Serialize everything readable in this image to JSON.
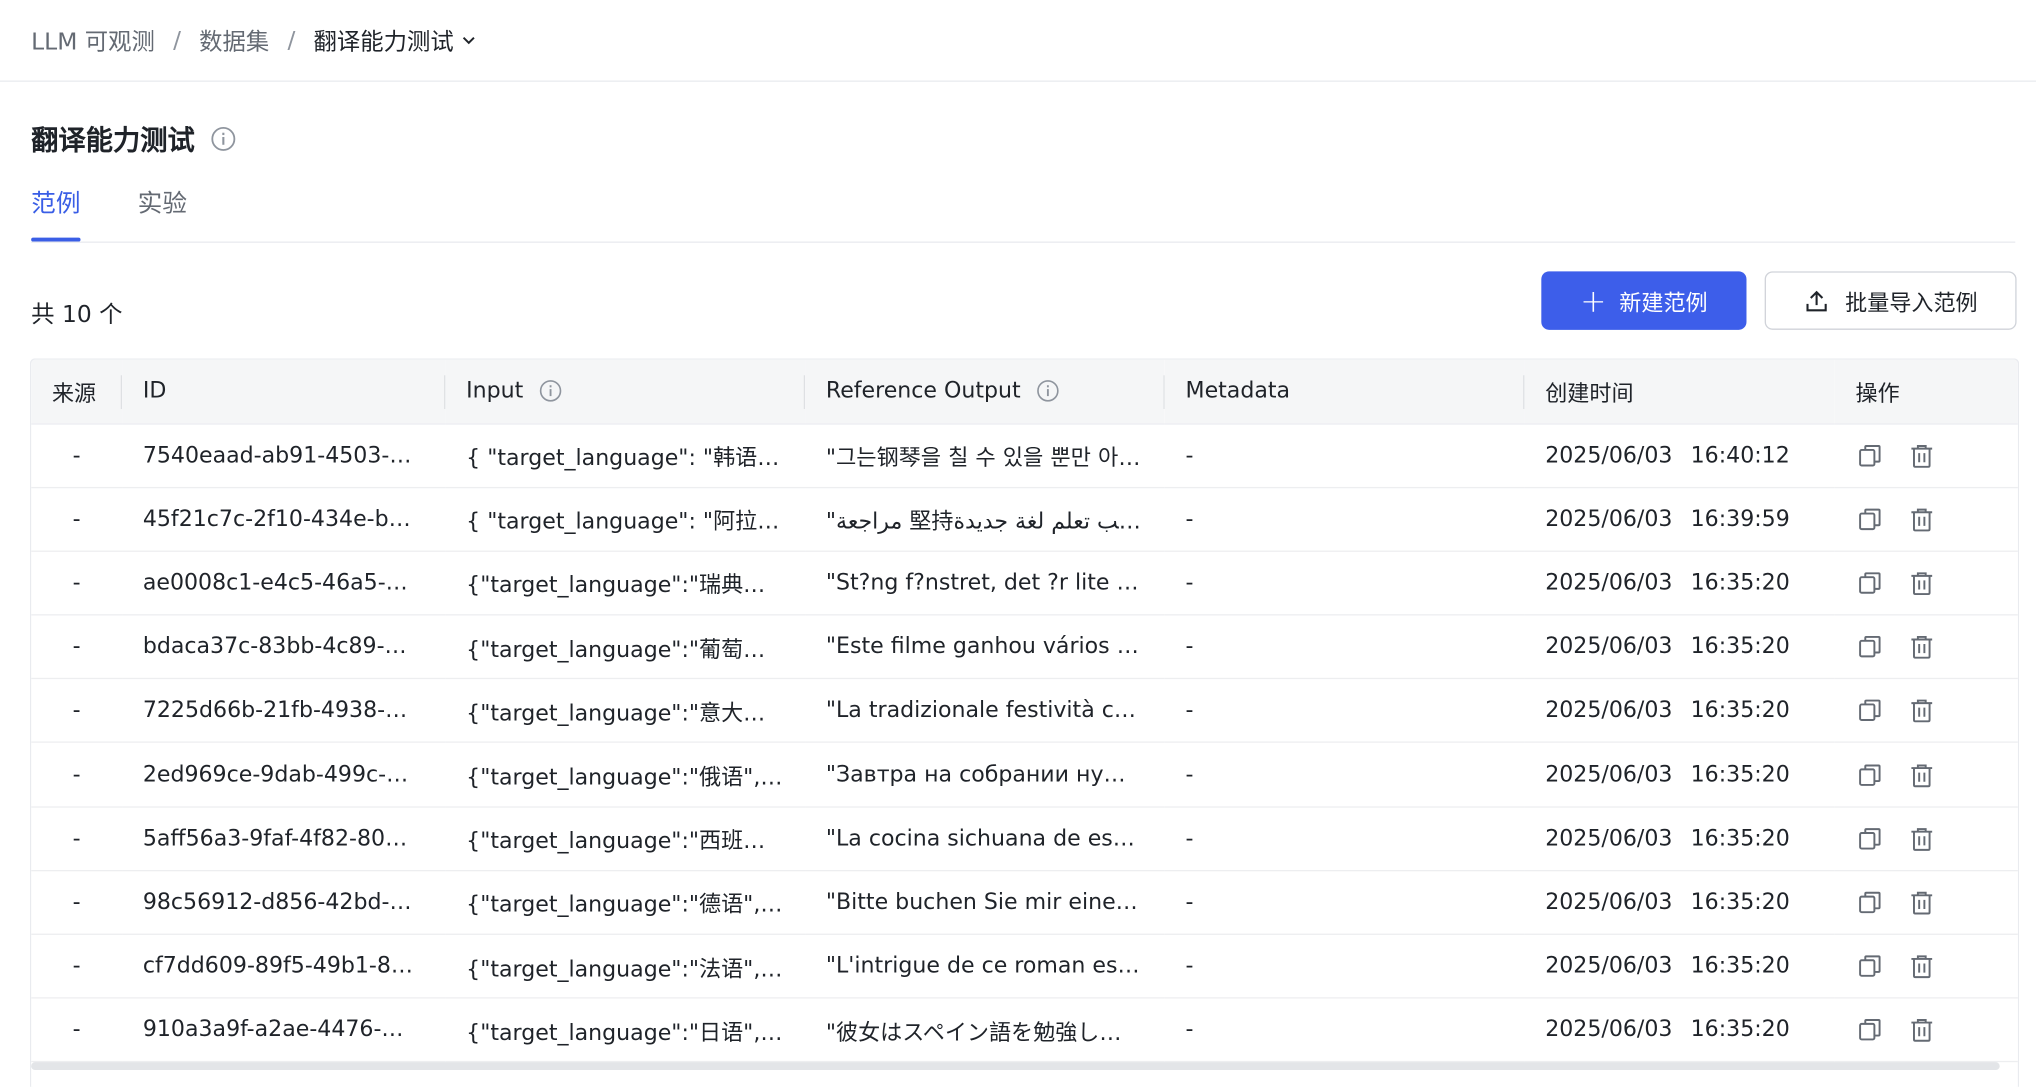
{
  "breadcrumb": {
    "items": [
      "LLM 可观测",
      "数据集"
    ],
    "current": "翻译能力测试",
    "separator": "/"
  },
  "page": {
    "title": "翻译能力测试"
  },
  "tabs": [
    {
      "label": "范例",
      "active": true
    },
    {
      "label": "实验",
      "active": false
    }
  ],
  "summary": {
    "count_text": "共 10 个"
  },
  "actions": {
    "new_label": "新建范例",
    "import_label": "批量导入范例"
  },
  "colors": {
    "accent": "#3d5eea",
    "text": "#1f2329",
    "muted": "#646a73"
  },
  "table": {
    "columns": {
      "source": "来源",
      "id": "ID",
      "input": "Input",
      "reference_output": "Reference Output",
      "metadata": "Metadata",
      "created": "创建时间",
      "ops": "操作"
    },
    "rows": [
      {
        "source": "-",
        "id": "7540eaad-ab91-4503-…",
        "input": "{ \"target_language\": \"韩语…",
        "output": "\"그는钢琴을 칠 수 있을 뿐만 아…",
        "metadata": "-",
        "date": "2025/06/03",
        "time": "16:40:12"
      },
      {
        "source": "-",
        "id": "45f21c7c-2f10-434e-b…",
        "input": "{ \"target_language\": \"阿拉…",
        "output": "\"مراجعة 堅持تتطلب تعلم لغة جديدة…",
        "metadata": "-",
        "date": "2025/06/03",
        "time": "16:39:59"
      },
      {
        "source": "-",
        "id": "ae0008c1-e4c5-46a5-…",
        "input": "{\"target_language\":\"瑞典…",
        "output": "\"St?ng f?nstret, det ?r lite k…",
        "metadata": "-",
        "date": "2025/06/03",
        "time": "16:35:20"
      },
      {
        "source": "-",
        "id": "bdaca37c-83bb-4c89-…",
        "input": "{\"target_language\":\"葡萄…",
        "output": "\"Este filme ganhou vários …",
        "metadata": "-",
        "date": "2025/06/03",
        "time": "16:35:20"
      },
      {
        "source": "-",
        "id": "7225d66b-21fb-4938-…",
        "input": "{\"target_language\":\"意大…",
        "output": "\"La tradizionale festività c…",
        "metadata": "-",
        "date": "2025/06/03",
        "time": "16:35:20"
      },
      {
        "source": "-",
        "id": "2ed969ce-9dab-499c-…",
        "input": "{\"target_language\":\"俄语\",…",
        "output": "\"Завтра на собрании ну…",
        "metadata": "-",
        "date": "2025/06/03",
        "time": "16:35:20"
      },
      {
        "source": "-",
        "id": "5aff56a3-9faf-4f82-80…",
        "input": "{\"target_language\":\"西班…",
        "output": "\"La cocina sichuana de es…",
        "metadata": "-",
        "date": "2025/06/03",
        "time": "16:35:20"
      },
      {
        "source": "-",
        "id": "98c56912-d856-42bd-…",
        "input": "{\"target_language\":\"德语\",…",
        "output": "\"Bitte buchen Sie mir eine…",
        "metadata": "-",
        "date": "2025/06/03",
        "time": "16:35:20"
      },
      {
        "source": "-",
        "id": "cf7dd609-89f5-49b1-8…",
        "input": "{\"target_language\":\"法语\",…",
        "output": "\"L'intrigue de ce roman es…",
        "metadata": "-",
        "date": "2025/06/03",
        "time": "16:35:20"
      },
      {
        "source": "-",
        "id": "910a3a9f-a2ae-4476-…",
        "input": "{\"target_language\":\"日语\",…",
        "output": "\"彼女はスペイン語を勉強し…",
        "metadata": "-",
        "date": "2025/06/03",
        "time": "16:35:20"
      }
    ]
  }
}
